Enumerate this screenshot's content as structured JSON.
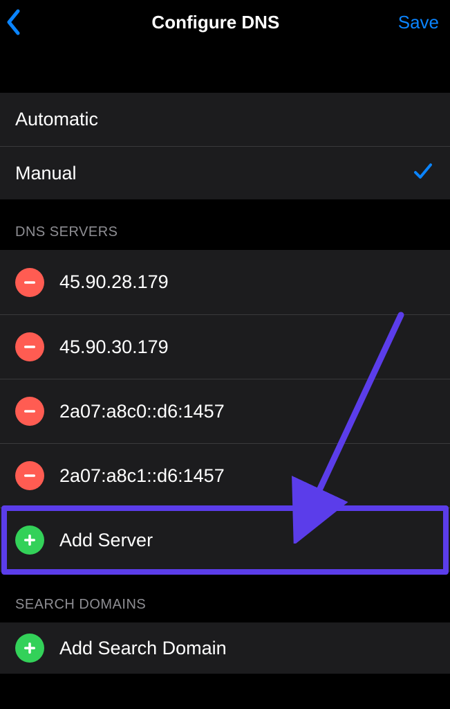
{
  "nav": {
    "title": "Configure DNS",
    "save": "Save"
  },
  "mode": {
    "automatic": "Automatic",
    "manual": "Manual"
  },
  "sections": {
    "dns_servers": "DNS SERVERS",
    "search_domains": "SEARCH DOMAINS"
  },
  "servers": [
    "45.90.28.179",
    "45.90.30.179",
    "2a07:a8c0::d6:1457",
    "2a07:a8c1::d6:1457"
  ],
  "actions": {
    "add_server": "Add Server",
    "add_search_domain": "Add Search Domain"
  }
}
